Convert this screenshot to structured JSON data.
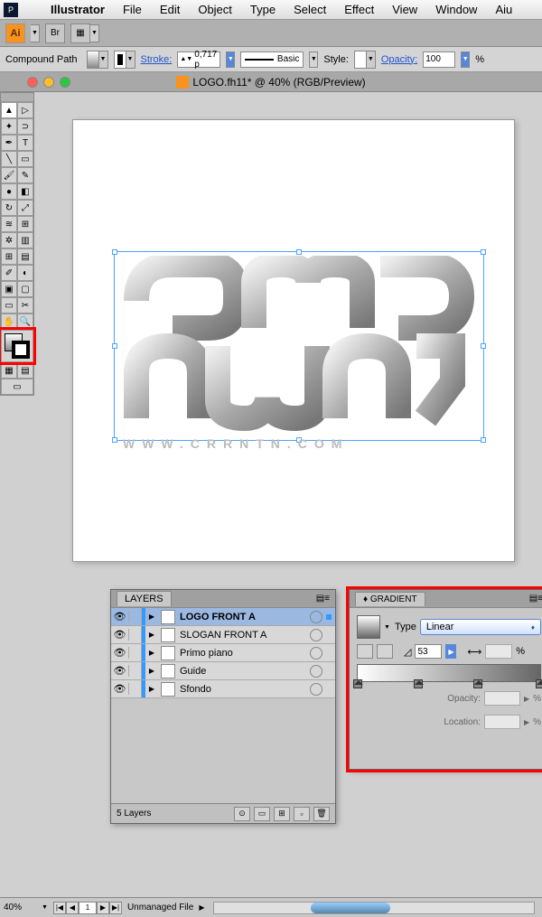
{
  "menubar": {
    "ps_badge": "P",
    "items": [
      "Illustrator",
      "File",
      "Edit",
      "Object",
      "Type",
      "Select",
      "Effect",
      "View",
      "Window",
      "Aiu"
    ]
  },
  "appbar": {
    "ai_badge": "Ai",
    "br_badge": "Br"
  },
  "controlbar": {
    "path_label": "Compound Path",
    "stroke_label": "Stroke:",
    "stroke_value": "0,717 p",
    "style_label": "Style:",
    "basic_label": "Basic",
    "opacity_label": "Opacity:",
    "opacity_value": "100",
    "percent": "%"
  },
  "doctab": {
    "title": "LOGO.fh11* @ 40% (RGB/Preview)"
  },
  "artboard": {
    "url_text": "WWW.CRRNTN.COM"
  },
  "layers": {
    "tab_label": "LAYERS",
    "items": [
      {
        "name": "LOGO FRONT A",
        "selected": true,
        "bold": true
      },
      {
        "name": "SLOGAN FRONT A",
        "selected": false
      },
      {
        "name": "Primo piano",
        "selected": false
      },
      {
        "name": "Guide",
        "selected": false
      },
      {
        "name": "Sfondo",
        "selected": false
      }
    ],
    "footer_count": "5 Layers"
  },
  "gradient": {
    "tab_label": "GRADIENT",
    "type_label": "Type",
    "type_value": "Linear",
    "angle_value": "53",
    "aspect_percent": "%",
    "opacity_label": "Opacity:",
    "opacity_percent": "%",
    "location_label": "Location:",
    "location_percent": "%",
    "stops": [
      0,
      33,
      66,
      100
    ]
  },
  "statusbar": {
    "zoom": "40%",
    "artboard_num": "1",
    "status_text": "Unmanaged File"
  }
}
